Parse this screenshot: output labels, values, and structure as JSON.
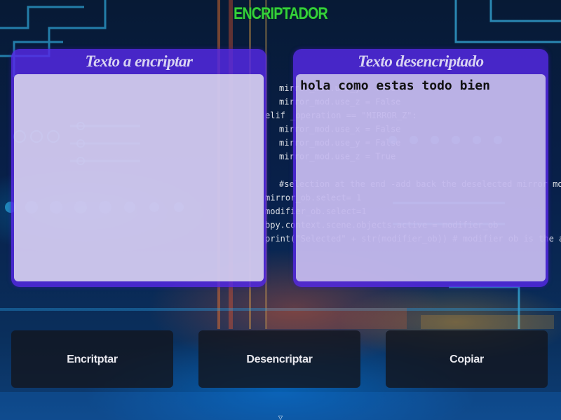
{
  "app": {
    "title": "ENCRIPTADOR"
  },
  "encrypt_panel": {
    "header": "Texto a encriptar",
    "input_value": "",
    "placeholder": ""
  },
  "decrypt_panel": {
    "header": "Texto desencriptado",
    "output_value": "hola como estas todo bien"
  },
  "buttons": {
    "encrypt_label": "Encritptar",
    "decrypt_label": "Desencriptar",
    "copy_label": "Copiar"
  },
  "background": {
    "code_lines": [
      "mirror_mod.use_y = True",
      "mirror_mod.use_z = False",
      "elif _operation == \"MIRROR_Z\":",
      "mirror_mod.use_x = False",
      "mirror_mod.use_y = False",
      "mirror_mod.use_z = True",
      "#selection at the end -add back the deselected mirror modifier object",
      "mirror_ob.select= 1",
      "modifier_ob.select=1",
      "bpy.context.scene.objects.active = modifier_ob",
      "print(\"Selected\" + str(modifier_ob)) # modifier ob is the active ob"
    ]
  },
  "colors": {
    "title": "#34d13a",
    "panel": "#5528e6",
    "button_bg": "#121620"
  }
}
